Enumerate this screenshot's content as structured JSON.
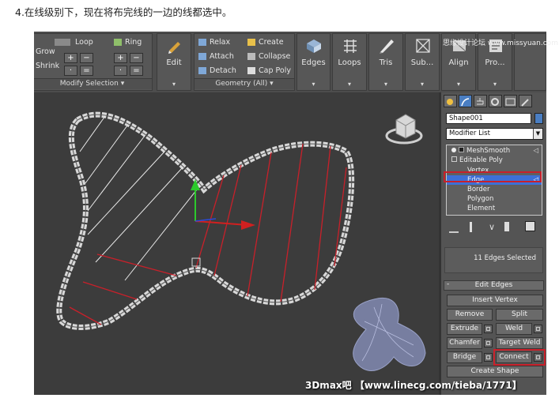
{
  "caption": "4.在线级别下，现在将布完线的一边的线都选中。",
  "ribbon": {
    "modify_selection": {
      "grow": "Grow",
      "shrink": "Shrink",
      "loop": "Loop",
      "ring": "Ring",
      "title": "Modify Selection ▾"
    },
    "edit": "Edit",
    "geometry": {
      "relax": "Relax",
      "attach": "Attach",
      "detach": "Detach",
      "create": "Create",
      "collapse": "Collapse",
      "cap_poly": "Cap Poly",
      "title": "Geometry (All) ▾"
    },
    "big_buttons": [
      "Edges",
      "Loops",
      "Tris",
      "Sub...",
      "Align",
      "Pro..."
    ],
    "arrow": "▾"
  },
  "watermark_top": "思缘设计论坛 www.missyuan.com",
  "panel": {
    "object_name": "Shape001",
    "modifier_list": "Modifier List",
    "stack": [
      "MeshSmooth",
      "Editable Poly",
      "Vertex",
      "Edge",
      "Border",
      "Polygon",
      "Element"
    ],
    "selection_status": "11 Edges Selected",
    "edit_edges_title": "Edit Edges",
    "buttons": {
      "insert_vertex": "Insert Vertex",
      "remove": "Remove",
      "split": "Split",
      "extrude": "Extrude",
      "weld": "Weld",
      "chamfer": "Chamfer",
      "target_weld": "Target Weld",
      "bridge": "Bridge",
      "connect": "Connect",
      "create_shape": "Create Shape"
    }
  },
  "watermark": "3Dmax吧 【www.linecg.com/tieba/1771】",
  "colors": {
    "selected_edge": "#c8202a",
    "highlight_box": "#c8202a",
    "active_row": "#3d6fd6"
  }
}
